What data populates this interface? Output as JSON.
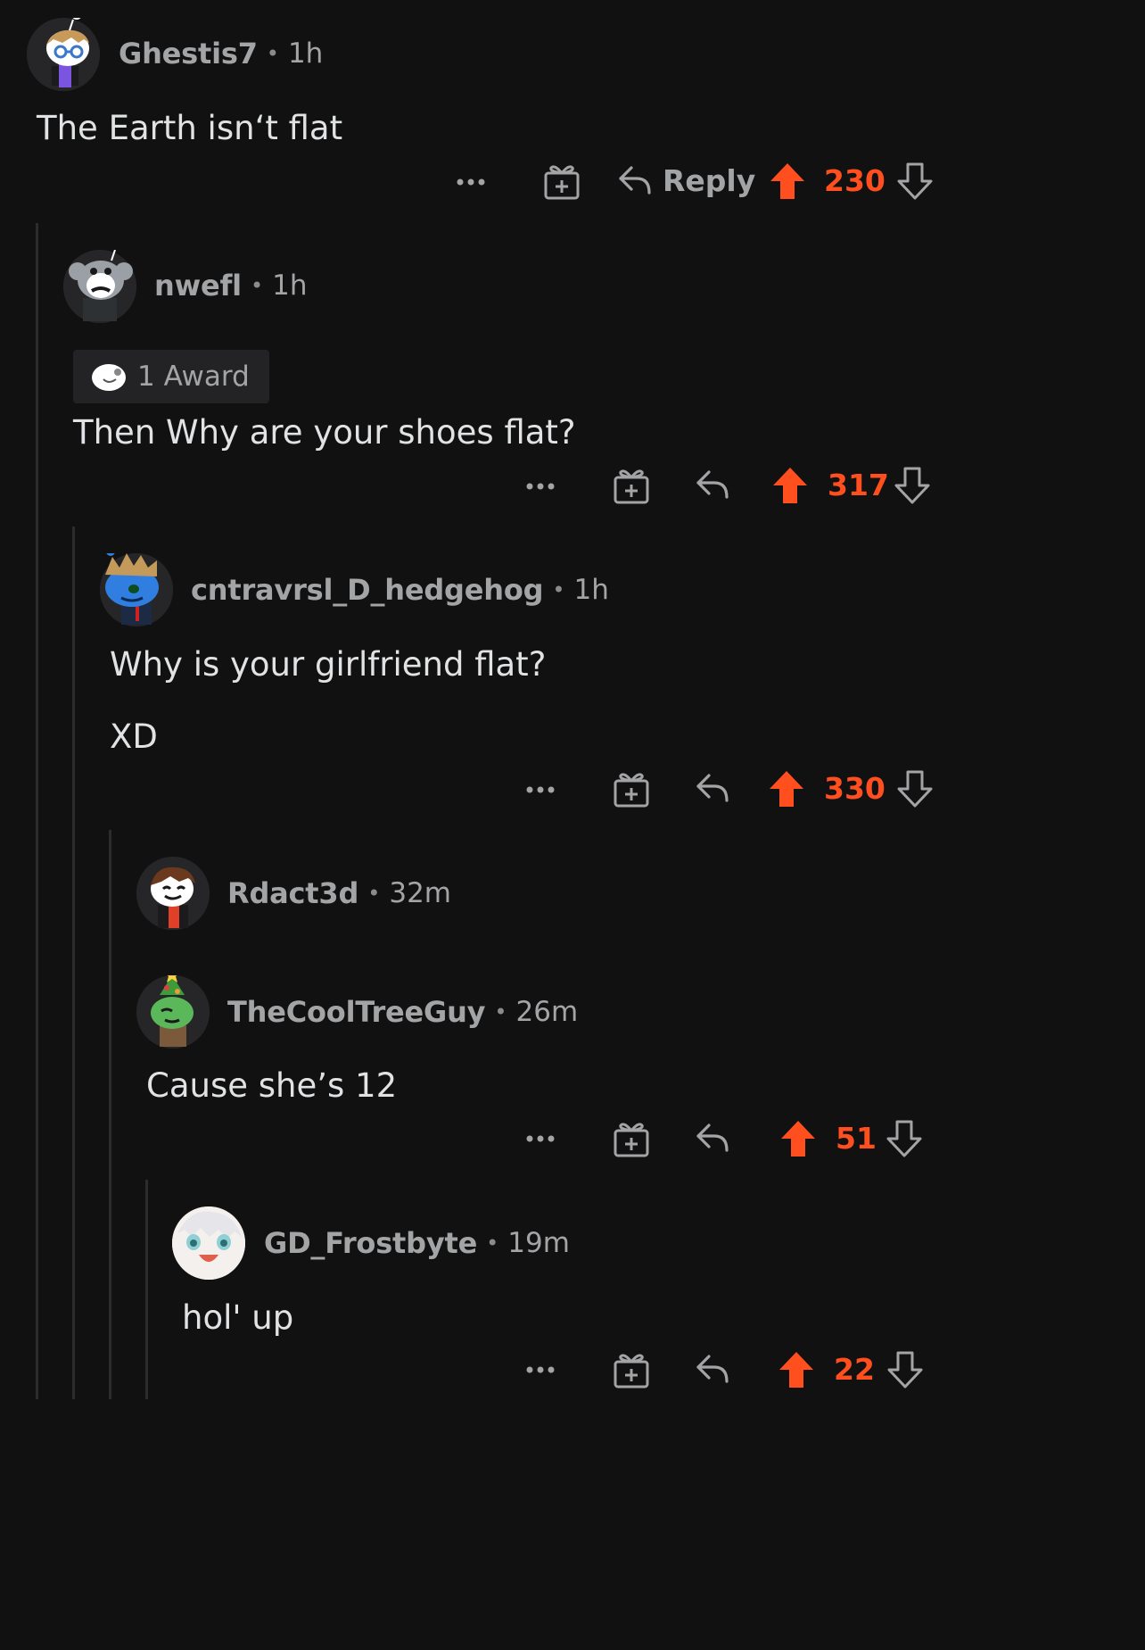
{
  "colors": {
    "background": "#111112",
    "upvote": "#ff4f1f",
    "meta": "#a3a4a6",
    "text": "#e1e2e3"
  },
  "comments": [
    {
      "username": "Ghestis7",
      "time": "1h",
      "body": [
        "The Earth isn‘t flat"
      ],
      "actions": {
        "reply_label": "Reply",
        "score": "230"
      }
    },
    {
      "username": "nwefl",
      "time": "1h",
      "award": {
        "label": "1 Award"
      },
      "body": [
        "Then Why are your shoes flat?"
      ],
      "actions": {
        "score": "317"
      }
    },
    {
      "username": "cntravrsl_D_hedgehog",
      "time": "1h",
      "body": [
        "Why is your girlfriend flat?",
        "XD"
      ],
      "actions": {
        "score": "330"
      }
    },
    {
      "username": "Rdact3d",
      "time": "32m",
      "body": []
    },
    {
      "username": "TheCoolTreeGuy",
      "time": "26m",
      "body": [
        "Cause she’s 12"
      ],
      "actions": {
        "score": "51"
      }
    },
    {
      "username": "GD_Frostbyte",
      "time": "19m",
      "body": [
        "hol' up"
      ],
      "actions": {
        "score": "22"
      }
    }
  ],
  "icons": {
    "more": "more-options-icon",
    "gift": "award-gift-icon",
    "reply": "reply-arrow-icon",
    "upvote": "upvote-arrow-icon",
    "downvote": "downvote-arrow-icon"
  }
}
